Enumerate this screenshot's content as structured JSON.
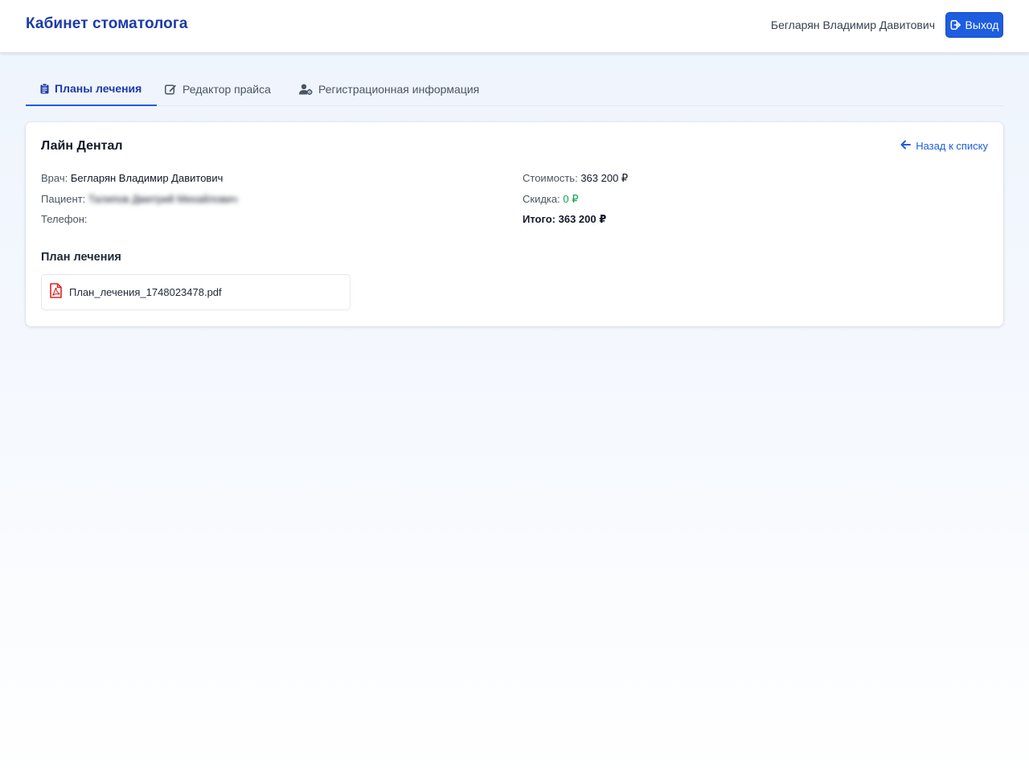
{
  "header": {
    "title": "Кабинет стоматолога",
    "user_name": "Бегларян Владимир Давитович",
    "logout_label": "Выход"
  },
  "tabs": [
    {
      "label": "Планы лечения",
      "icon": "clipboard-icon",
      "active": true
    },
    {
      "label": "Редактор прайса",
      "icon": "edit-icon",
      "active": false
    },
    {
      "label": "Регистрационная информация",
      "icon": "user-gear-icon",
      "active": false
    }
  ],
  "detail": {
    "clinic_name": "Лайн Дентал",
    "back_label": "Назад к списку",
    "doctor_label": "Врач:",
    "doctor_value": "Бегларян Владимир Давитович",
    "patient_label": "Пациент:",
    "patient_value": "Талипов Дмитрий Михайлович",
    "phone_label": "Телефон:",
    "phone_value": "",
    "cost_label": "Стоимость:",
    "cost_value": "363 200 ₽",
    "discount_label": "Скидка:",
    "discount_value": "0 ₽",
    "total_text": "Итого: 363 200 ₽",
    "plan_title": "План лечения",
    "file_name": "План_лечения_1748023478.pdf",
    "file_icon": "pdf-file-icon"
  },
  "colors": {
    "brand": "#1c3aa9",
    "accent": "#1d5de0",
    "discount_green": "#16a34a",
    "pdf_red": "#dc2626"
  }
}
